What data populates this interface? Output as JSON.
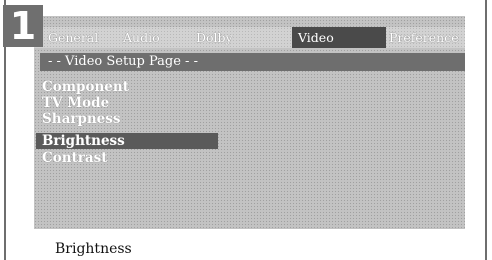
{
  "step_number": "1",
  "menu": {
    "tabs": [
      {
        "label": "General"
      },
      {
        "label": "Audio"
      },
      {
        "label": "Dolby"
      },
      {
        "label": "Video"
      },
      {
        "label": "Preference"
      }
    ],
    "active_tab": "Video"
  },
  "page_title": "- - Video Setup Page - -",
  "options": [
    {
      "label": "Component"
    },
    {
      "label": "TV Mode"
    },
    {
      "label": "Sharpness"
    },
    {
      "label": "Brightness"
    },
    {
      "label": "Contrast"
    }
  ],
  "selected_option": "Brightness",
  "status_text": "Brightness",
  "colors": {
    "screen_background": "#c3c3c3",
    "title_bar": "#6e6e6e",
    "active_tab": "#4a4a4a",
    "selected_option": "#5a5a5a",
    "text": "#ffffff"
  }
}
